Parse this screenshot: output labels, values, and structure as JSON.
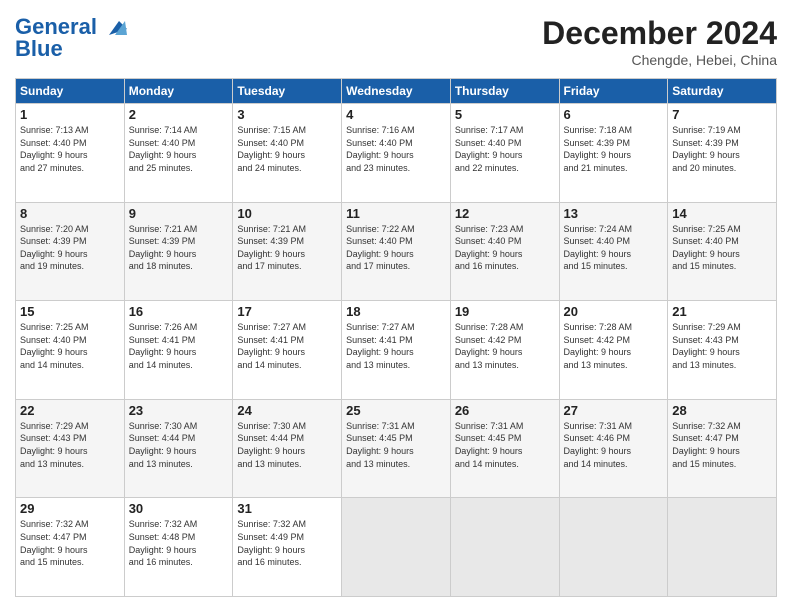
{
  "header": {
    "logo_line1": "General",
    "logo_line2": "Blue",
    "month": "December 2024",
    "location": "Chengde, Hebei, China"
  },
  "weekdays": [
    "Sunday",
    "Monday",
    "Tuesday",
    "Wednesday",
    "Thursday",
    "Friday",
    "Saturday"
  ],
  "weeks": [
    [
      {
        "day": "1",
        "lines": [
          "Sunrise: 7:13 AM",
          "Sunset: 4:40 PM",
          "Daylight: 9 hours",
          "and 27 minutes."
        ]
      },
      {
        "day": "2",
        "lines": [
          "Sunrise: 7:14 AM",
          "Sunset: 4:40 PM",
          "Daylight: 9 hours",
          "and 25 minutes."
        ]
      },
      {
        "day": "3",
        "lines": [
          "Sunrise: 7:15 AM",
          "Sunset: 4:40 PM",
          "Daylight: 9 hours",
          "and 24 minutes."
        ]
      },
      {
        "day": "4",
        "lines": [
          "Sunrise: 7:16 AM",
          "Sunset: 4:40 PM",
          "Daylight: 9 hours",
          "and 23 minutes."
        ]
      },
      {
        "day": "5",
        "lines": [
          "Sunrise: 7:17 AM",
          "Sunset: 4:40 PM",
          "Daylight: 9 hours",
          "and 22 minutes."
        ]
      },
      {
        "day": "6",
        "lines": [
          "Sunrise: 7:18 AM",
          "Sunset: 4:39 PM",
          "Daylight: 9 hours",
          "and 21 minutes."
        ]
      },
      {
        "day": "7",
        "lines": [
          "Sunrise: 7:19 AM",
          "Sunset: 4:39 PM",
          "Daylight: 9 hours",
          "and 20 minutes."
        ]
      }
    ],
    [
      {
        "day": "8",
        "lines": [
          "Sunrise: 7:20 AM",
          "Sunset: 4:39 PM",
          "Daylight: 9 hours",
          "and 19 minutes."
        ]
      },
      {
        "day": "9",
        "lines": [
          "Sunrise: 7:21 AM",
          "Sunset: 4:39 PM",
          "Daylight: 9 hours",
          "and 18 minutes."
        ]
      },
      {
        "day": "10",
        "lines": [
          "Sunrise: 7:21 AM",
          "Sunset: 4:39 PM",
          "Daylight: 9 hours",
          "and 17 minutes."
        ]
      },
      {
        "day": "11",
        "lines": [
          "Sunrise: 7:22 AM",
          "Sunset: 4:40 PM",
          "Daylight: 9 hours",
          "and 17 minutes."
        ]
      },
      {
        "day": "12",
        "lines": [
          "Sunrise: 7:23 AM",
          "Sunset: 4:40 PM",
          "Daylight: 9 hours",
          "and 16 minutes."
        ]
      },
      {
        "day": "13",
        "lines": [
          "Sunrise: 7:24 AM",
          "Sunset: 4:40 PM",
          "Daylight: 9 hours",
          "and 15 minutes."
        ]
      },
      {
        "day": "14",
        "lines": [
          "Sunrise: 7:25 AM",
          "Sunset: 4:40 PM",
          "Daylight: 9 hours",
          "and 15 minutes."
        ]
      }
    ],
    [
      {
        "day": "15",
        "lines": [
          "Sunrise: 7:25 AM",
          "Sunset: 4:40 PM",
          "Daylight: 9 hours",
          "and 14 minutes."
        ]
      },
      {
        "day": "16",
        "lines": [
          "Sunrise: 7:26 AM",
          "Sunset: 4:41 PM",
          "Daylight: 9 hours",
          "and 14 minutes."
        ]
      },
      {
        "day": "17",
        "lines": [
          "Sunrise: 7:27 AM",
          "Sunset: 4:41 PM",
          "Daylight: 9 hours",
          "and 14 minutes."
        ]
      },
      {
        "day": "18",
        "lines": [
          "Sunrise: 7:27 AM",
          "Sunset: 4:41 PM",
          "Daylight: 9 hours",
          "and 13 minutes."
        ]
      },
      {
        "day": "19",
        "lines": [
          "Sunrise: 7:28 AM",
          "Sunset: 4:42 PM",
          "Daylight: 9 hours",
          "and 13 minutes."
        ]
      },
      {
        "day": "20",
        "lines": [
          "Sunrise: 7:28 AM",
          "Sunset: 4:42 PM",
          "Daylight: 9 hours",
          "and 13 minutes."
        ]
      },
      {
        "day": "21",
        "lines": [
          "Sunrise: 7:29 AM",
          "Sunset: 4:43 PM",
          "Daylight: 9 hours",
          "and 13 minutes."
        ]
      }
    ],
    [
      {
        "day": "22",
        "lines": [
          "Sunrise: 7:29 AM",
          "Sunset: 4:43 PM",
          "Daylight: 9 hours",
          "and 13 minutes."
        ]
      },
      {
        "day": "23",
        "lines": [
          "Sunrise: 7:30 AM",
          "Sunset: 4:44 PM",
          "Daylight: 9 hours",
          "and 13 minutes."
        ]
      },
      {
        "day": "24",
        "lines": [
          "Sunrise: 7:30 AM",
          "Sunset: 4:44 PM",
          "Daylight: 9 hours",
          "and 13 minutes."
        ]
      },
      {
        "day": "25",
        "lines": [
          "Sunrise: 7:31 AM",
          "Sunset: 4:45 PM",
          "Daylight: 9 hours",
          "and 13 minutes."
        ]
      },
      {
        "day": "26",
        "lines": [
          "Sunrise: 7:31 AM",
          "Sunset: 4:45 PM",
          "Daylight: 9 hours",
          "and 14 minutes."
        ]
      },
      {
        "day": "27",
        "lines": [
          "Sunrise: 7:31 AM",
          "Sunset: 4:46 PM",
          "Daylight: 9 hours",
          "and 14 minutes."
        ]
      },
      {
        "day": "28",
        "lines": [
          "Sunrise: 7:32 AM",
          "Sunset: 4:47 PM",
          "Daylight: 9 hours",
          "and 15 minutes."
        ]
      }
    ],
    [
      {
        "day": "29",
        "lines": [
          "Sunrise: 7:32 AM",
          "Sunset: 4:47 PM",
          "Daylight: 9 hours",
          "and 15 minutes."
        ]
      },
      {
        "day": "30",
        "lines": [
          "Sunrise: 7:32 AM",
          "Sunset: 4:48 PM",
          "Daylight: 9 hours",
          "and 16 minutes."
        ]
      },
      {
        "day": "31",
        "lines": [
          "Sunrise: 7:32 AM",
          "Sunset: 4:49 PM",
          "Daylight: 9 hours",
          "and 16 minutes."
        ]
      },
      {
        "day": "",
        "lines": []
      },
      {
        "day": "",
        "lines": []
      },
      {
        "day": "",
        "lines": []
      },
      {
        "day": "",
        "lines": []
      }
    ]
  ]
}
